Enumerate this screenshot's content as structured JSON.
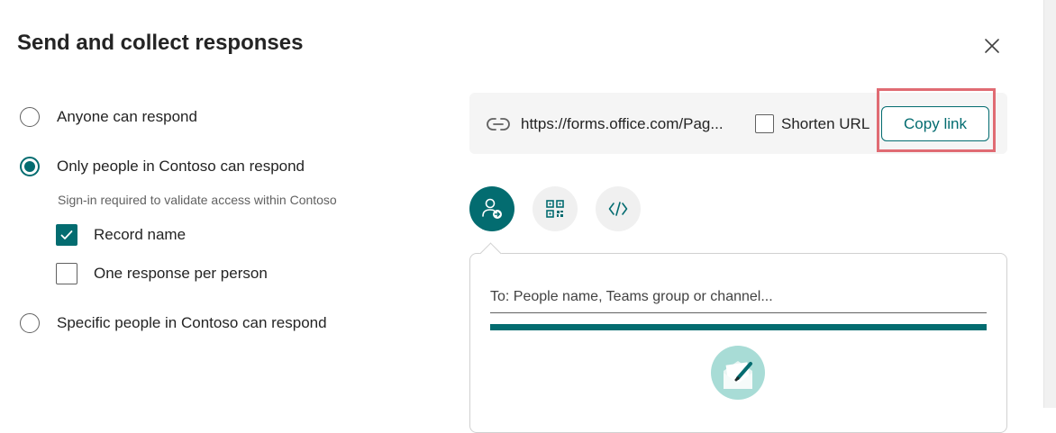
{
  "dialog": {
    "title": "Send and collect responses",
    "close_icon": "close-icon"
  },
  "permissions": {
    "options": [
      {
        "label": "Anyone can respond",
        "selected": false
      },
      {
        "label": "Only people in Contoso can respond",
        "selected": true
      },
      {
        "label": "Specific people in Contoso can respond",
        "selected": false
      }
    ],
    "signin_note": "Sign-in required to validate access within Contoso",
    "checkboxes": [
      {
        "label": "Record name",
        "checked": true
      },
      {
        "label": "One response per person",
        "checked": false
      }
    ]
  },
  "link": {
    "icon": "link-icon",
    "url": "https://forms.office.com/Pag...",
    "shorten_label": "Shorten URL",
    "shorten_checked": false,
    "copy_label": "Copy link"
  },
  "share_tabs": [
    {
      "icon": "person-send-icon",
      "active": true
    },
    {
      "icon": "qr-code-icon",
      "active": false
    },
    {
      "icon": "embed-code-icon",
      "active": false
    }
  ],
  "email": {
    "to_placeholder": "To: People name, Teams group or channel...",
    "to_value": "",
    "progress": 1.0,
    "illustration_icon": "envelope-pencil-icon"
  },
  "colors": {
    "accent": "#036c70",
    "highlight": "#e06b73",
    "panel_bg": "#f5f5f5"
  }
}
